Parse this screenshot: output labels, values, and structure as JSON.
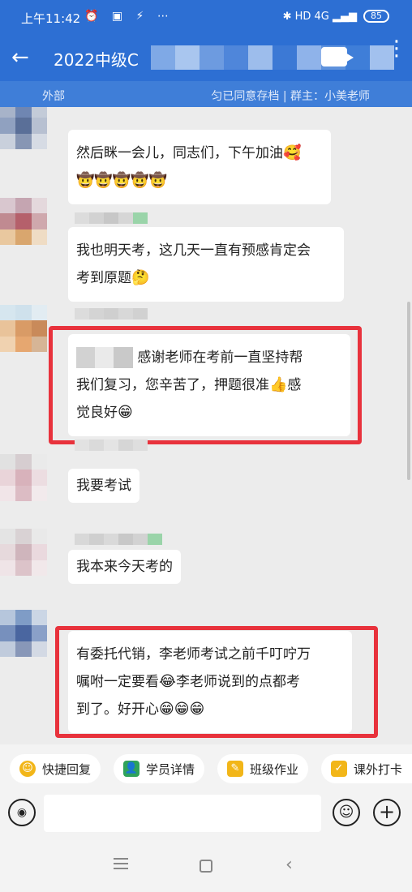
{
  "status_bar": {
    "time": "上午11:42",
    "left_icons": "⏰ ▣ ⚡ ⋯",
    "right_icons": "✱ HD 4G ▂▄▆",
    "battery": "85"
  },
  "header": {
    "title": "2022中级C",
    "more": "⋮"
  },
  "subbar": {
    "left": "外部",
    "right": "匀已同意存档 | 群主：小美老师"
  },
  "messages": [
    {
      "line1": "然后眯一会儿，同志们，下午加油",
      "emoji1": "🥰",
      "line2": "🤠🤠🤠🤠🤠"
    },
    {
      "line1": "我也明天考，这几天一直有预感肯定会",
      "line2": "考到原题",
      "emoji2": "🤔"
    },
    {
      "line1": "感谢老师在考前一直坚持帮",
      "line2": "我们复习，您辛苦了，押题很准",
      "emoji2": "👍",
      "line2b": "感",
      "line3": "觉良好",
      "emoji3": "😁"
    },
    {
      "line1": "我要考试"
    },
    {
      "line1": "我本来今天考的"
    },
    {
      "line1": "有委托代销，李老师考试之前千叮咛万",
      "line2": "嘱咐一定要看",
      "emoji2": "😂",
      "line2b": "李老师说到的点都考",
      "line3": "到了。好开心",
      "emoji3": "😁😁😁"
    }
  ],
  "quick_actions": [
    {
      "label": "快捷回复",
      "icon": "☺"
    },
    {
      "label": "学员详情",
      "icon": "👤"
    },
    {
      "label": "班级作业",
      "icon": "✎"
    },
    {
      "label": "课外打卡",
      "icon": "✓"
    }
  ],
  "input": {
    "placeholder": ""
  },
  "colors": {
    "header_bg": "#2d6fd3",
    "highlight": "#e8323c"
  }
}
